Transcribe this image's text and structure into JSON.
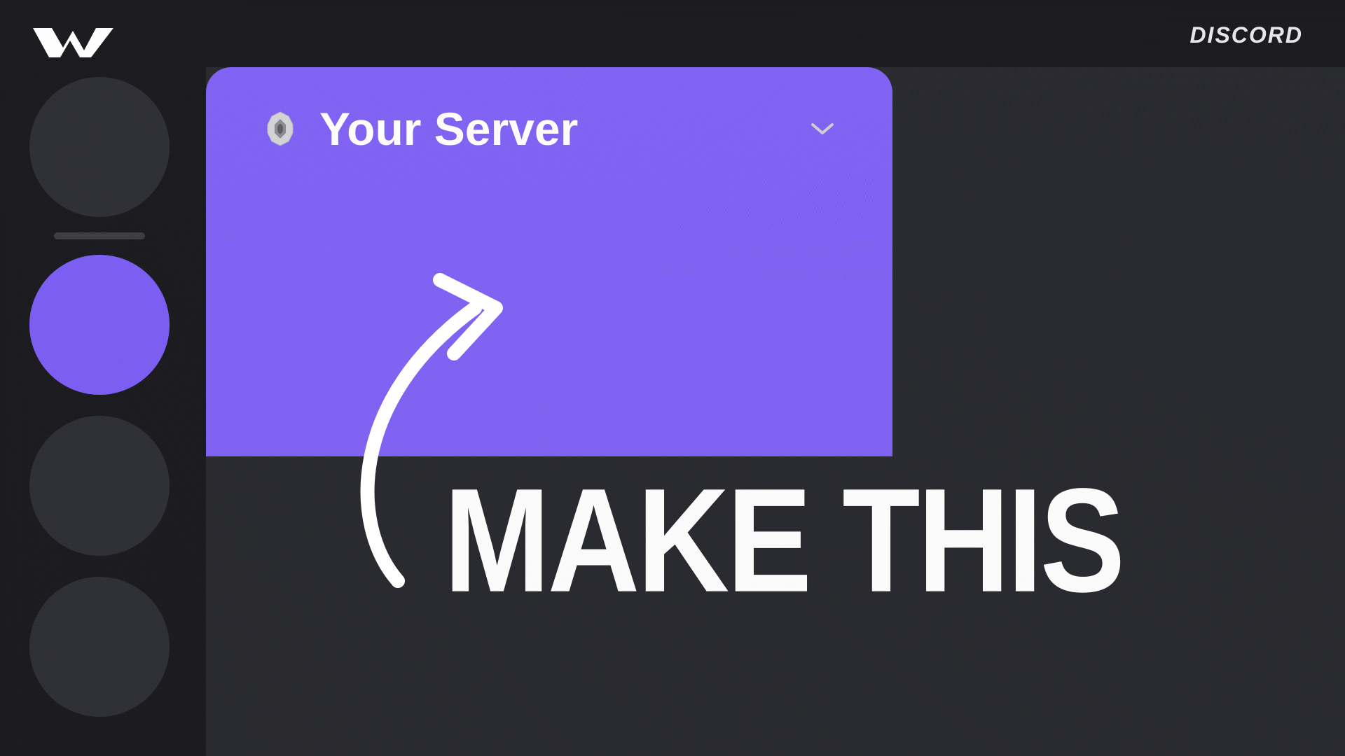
{
  "header": {
    "app_label": "DISCORD"
  },
  "server": {
    "name": "Your Server"
  },
  "headline": "MAKE THIS",
  "colors": {
    "accent": "#7c5cf5",
    "background": "#18181c",
    "panel": "#26272c"
  },
  "sidebar": {
    "servers": [
      {
        "active": false
      },
      {
        "active": true
      },
      {
        "active": false
      },
      {
        "active": false
      }
    ]
  }
}
